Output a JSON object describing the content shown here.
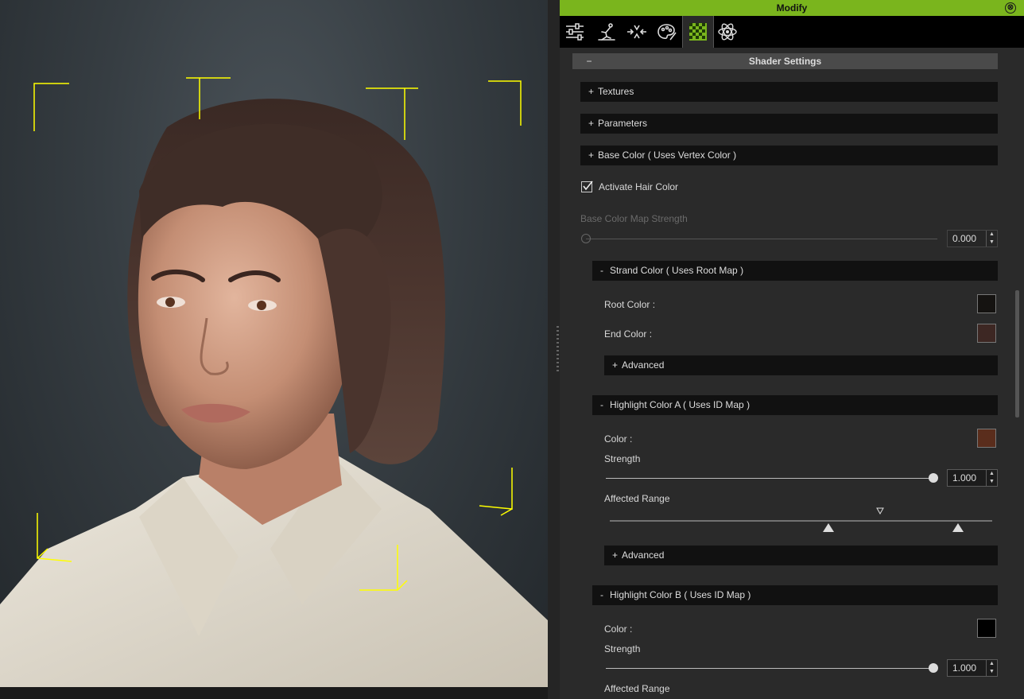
{
  "window": {
    "title": "Modify",
    "close_glyph": "⊗"
  },
  "toolbar": {
    "tools": [
      "sliders-icon",
      "pose-icon",
      "morph-icon",
      "palette-icon",
      "material-checker-icon",
      "physics-atom-icon"
    ],
    "active_tool": "material-checker-icon"
  },
  "shader": {
    "header": "Shader Settings",
    "header_sign": "−",
    "sections": {
      "textures": "Textures",
      "parameters": "Parameters",
      "base_color": "Base Color ( Uses Vertex Color )"
    },
    "activate_hair_color": {
      "label": "Activate Hair Color",
      "checked": true
    },
    "base_color_map_strength": {
      "label": "Base Color Map Strength",
      "value": "0.000",
      "disabled": true
    }
  },
  "strand_color": {
    "header": "Strand Color ( Uses Root Map )",
    "root_color_label": "Root Color :",
    "root_color": "#151311",
    "end_color_label": "End Color :",
    "end_color": "#3d2723",
    "advanced": "Advanced"
  },
  "highlight_a": {
    "header": "Highlight Color A ( Uses ID Map )",
    "color_label": "Color :",
    "color": "#5a2d1c",
    "strength_label": "Strength",
    "strength_value": "1.000",
    "strength_fraction": 1.0,
    "affected_range_label": "Affected Range",
    "advanced": "Advanced"
  },
  "highlight_b": {
    "header": "Highlight Color B ( Uses ID Map )",
    "color_label": "Color :",
    "color": "#000000",
    "strength_label": "Strength",
    "strength_value": "1.000",
    "strength_fraction": 1.0,
    "affected_range_label": "Affected Range"
  },
  "signs": {
    "plus": "+",
    "minus": "-"
  },
  "colors": {
    "accent": "#7ab51d",
    "gizmo": "#ffff00"
  }
}
